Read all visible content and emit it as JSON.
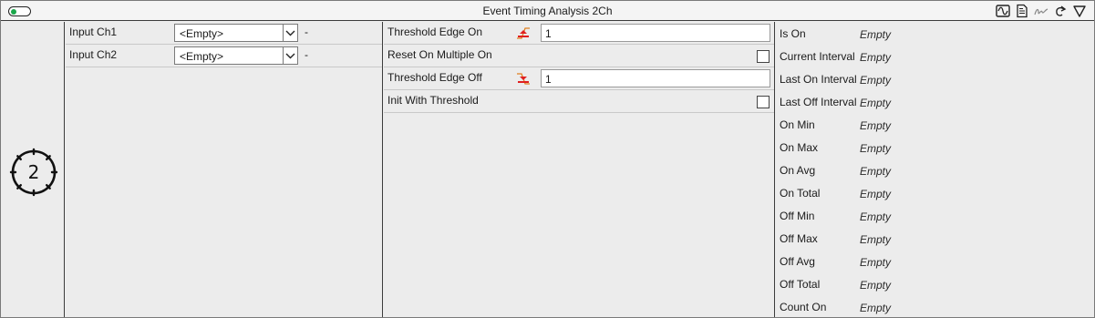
{
  "window": {
    "title": "Event Timing Analysis 2Ch",
    "enabled": true
  },
  "toolbar_icons": [
    "waveform-icon",
    "document-icon",
    "signature-icon",
    "redo-icon",
    "collapse-triangle-icon"
  ],
  "badge": {
    "number": "2"
  },
  "inputs": [
    {
      "label": "Input Ch1",
      "value": "<Empty>",
      "unit": "-"
    },
    {
      "label": "Input Ch2",
      "value": "<Empty>",
      "unit": "-"
    }
  ],
  "params": {
    "threshold_edge_on": {
      "label": "Threshold Edge On",
      "value": "1"
    },
    "reset_on_multiple_on": {
      "label": "Reset On Multiple On",
      "checked": false
    },
    "threshold_edge_off": {
      "label": "Threshold Edge Off",
      "value": "1"
    },
    "init_with_threshold": {
      "label": "Init With Threshold",
      "checked": false
    }
  },
  "results": [
    {
      "label": "Is On",
      "value": "Empty"
    },
    {
      "label": "Current Interval",
      "value": "Empty"
    },
    {
      "label": "Last On Interval",
      "value": "Empty"
    },
    {
      "label": "Last Off Interval",
      "value": "Empty"
    },
    {
      "label": "On Min",
      "value": "Empty"
    },
    {
      "label": "On Max",
      "value": "Empty"
    },
    {
      "label": "On Avg",
      "value": "Empty"
    },
    {
      "label": "On Total",
      "value": "Empty"
    },
    {
      "label": "Off Min",
      "value": "Empty"
    },
    {
      "label": "Off Max",
      "value": "Empty"
    },
    {
      "label": "Off Avg",
      "value": "Empty"
    },
    {
      "label": "Off Total",
      "value": "Empty"
    },
    {
      "label": "Count On",
      "value": "Empty"
    }
  ],
  "colors": {
    "edge_icon": "#e02020",
    "toggle_on": "#1aa64a"
  }
}
